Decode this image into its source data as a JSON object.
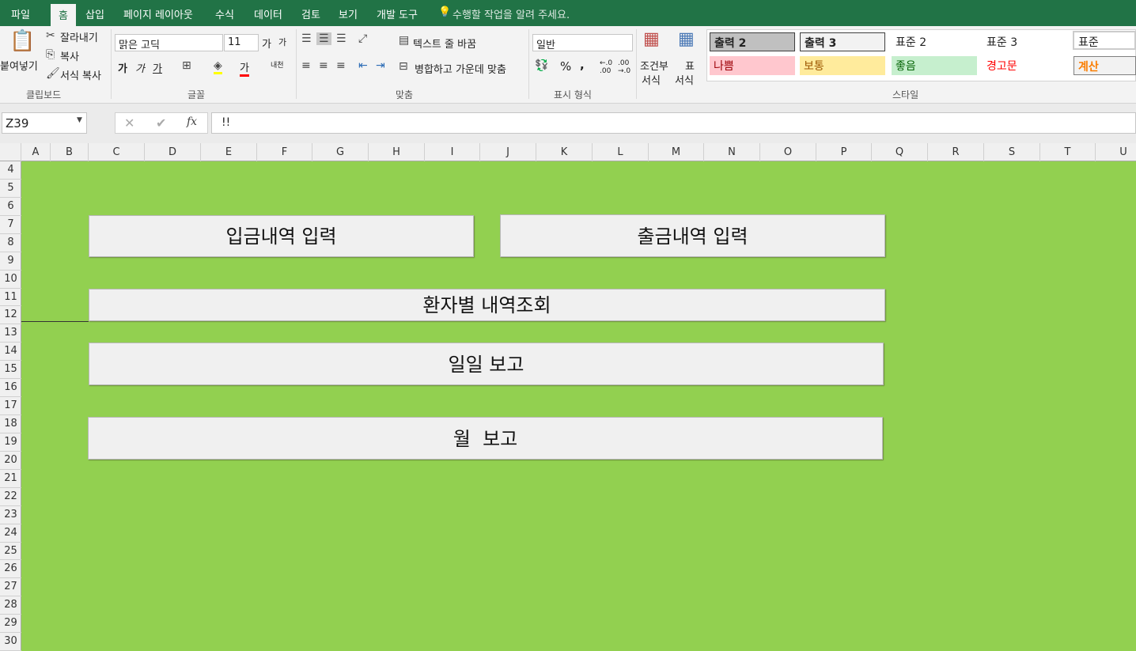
{
  "tabs": [
    "파일",
    "홈",
    "삽입",
    "페이지 레이아웃",
    "수식",
    "데이터",
    "검토",
    "보기",
    "개발 도구"
  ],
  "active_tab": "홈",
  "tell_me": "수행할 작업을 알려 주세요.",
  "clipboard": {
    "paste": "붙여넣기",
    "cut": "잘라내기",
    "copy": "복사",
    "format_painter": "서식 복사",
    "label": "클립보드"
  },
  "font": {
    "name": "맑은 고딕",
    "size": "11",
    "bold": "가",
    "italic": "가",
    "underline": "가",
    "label": "글꼴",
    "grow": "가",
    "shrink": "가",
    "color": "가",
    "phonetic": "내천"
  },
  "alignment": {
    "wrap": "텍스트 줄 바꿈",
    "merge": "병합하고 가운데 맞춤",
    "label": "맞춤"
  },
  "number": {
    "format": "일반",
    "percent": "%",
    "comma": ",",
    "label": "표시 형식",
    "inc": "←.0 .00",
    "dec": ".00 →.0"
  },
  "styles": {
    "cond": "조건부",
    "cond2": "서식",
    "table": "표",
    "table2": "서식",
    "label": "스타일",
    "items": [
      {
        "label": "출력 2",
        "bg": "#c0c0c0",
        "fg": "#222"
      },
      {
        "label": "출력 3",
        "bg": "#f2f2f2",
        "fg": "#222"
      },
      {
        "label": "표준 2",
        "bg": "#fff",
        "fg": "#222"
      },
      {
        "label": "표준 3",
        "bg": "#fff",
        "fg": "#222"
      },
      {
        "label": "표준",
        "bg": "#fff",
        "fg": "#222"
      },
      {
        "label": "나쁨",
        "bg": "#ffc7ce",
        "fg": "#9c0006"
      },
      {
        "label": "보통",
        "bg": "#ffeb9c",
        "fg": "#9c5700"
      },
      {
        "label": "좋음",
        "bg": "#c6efce",
        "fg": "#006100"
      },
      {
        "label": "경고문",
        "bg": "#fff",
        "fg": "#ff0000"
      },
      {
        "label": "계산",
        "bg": "#f2f2f2",
        "fg": "#fa7d00"
      }
    ]
  },
  "name_box": "Z39",
  "formula": "!!",
  "fx": "fx",
  "columns": [
    "A",
    "B",
    "C",
    "D",
    "E",
    "F",
    "G",
    "H",
    "I",
    "J",
    "K",
    "L",
    "M",
    "N",
    "O",
    "P",
    "Q",
    "R",
    "S",
    "T",
    "U"
  ],
  "rows": [
    "4",
    "5",
    "6",
    "7",
    "8",
    "9",
    "10",
    "11",
    "12",
    "13",
    "14",
    "15",
    "16",
    "17",
    "18",
    "19",
    "20",
    "21",
    "22",
    "23",
    "24",
    "25",
    "26",
    "27",
    "28",
    "29",
    "30"
  ],
  "sheet_bg": "#92d050",
  "buttons": {
    "deposit": "입금내역 입력",
    "withdraw": "출금내역 입력",
    "patient": "환자별 내역조회",
    "daily": "일일 보고",
    "monthly": "월  보고"
  }
}
